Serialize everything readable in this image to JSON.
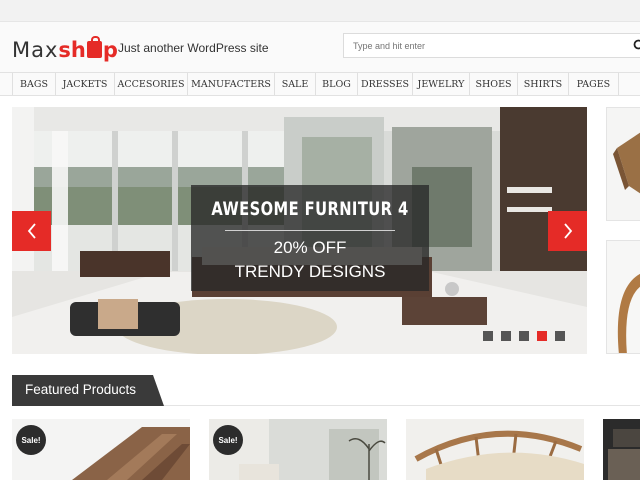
{
  "site": {
    "logo_part1": "Max",
    "logo_part2a": "sh",
    "logo_part2b": "p",
    "tagline": "Just another WordPress site",
    "brand_color": "#e52b27"
  },
  "search": {
    "placeholder": "Type and hit enter",
    "icon": "search-icon"
  },
  "nav": {
    "items": [
      "BAGS",
      "JACKETS",
      "ACCESORIES",
      "MANUFACTERS",
      "SALE",
      "BLOG",
      "DRESSES",
      "JEWELRY",
      "SHOES",
      "SHIRTS",
      "PAGES"
    ]
  },
  "slider": {
    "title": "AWESOME FURNITUR 4",
    "subtitle1": "20% OFF",
    "subtitle2": "TRENDY DESIGNS",
    "prev_icon": "chevron-left-icon",
    "next_icon": "chevron-right-icon",
    "slide_count": 5,
    "active_slide": 4
  },
  "featured": {
    "title": "Featured Products",
    "sale_label": "Sale!"
  }
}
